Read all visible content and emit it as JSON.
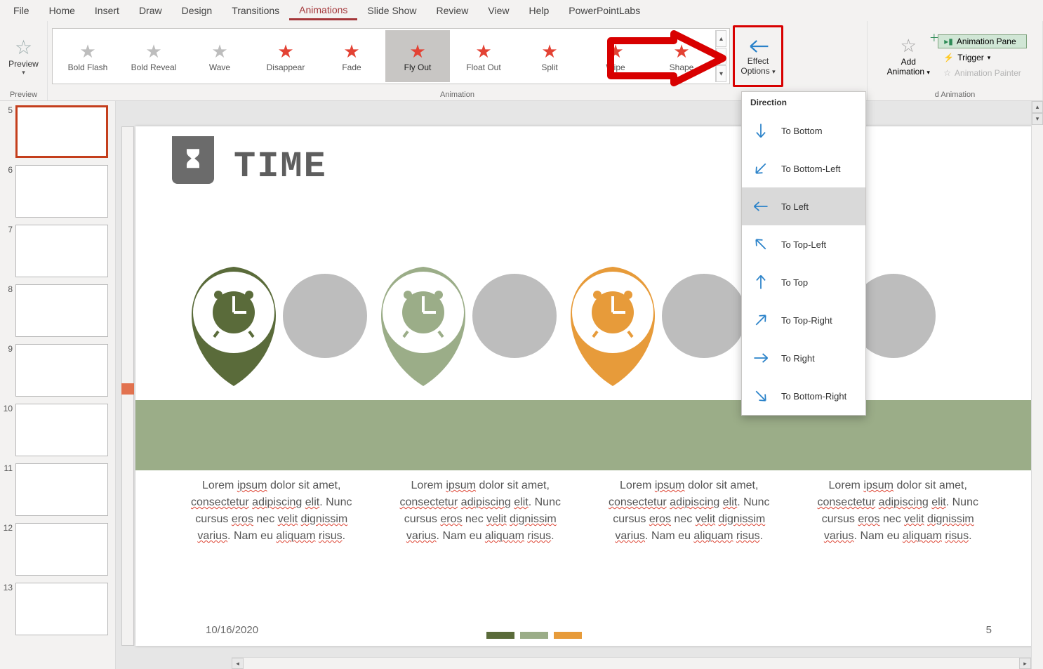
{
  "tabs": {
    "file": "File",
    "home": "Home",
    "insert": "Insert",
    "draw": "Draw",
    "design": "Design",
    "transitions": "Transitions",
    "animations": "Animations",
    "slideshow": "Slide Show",
    "review": "Review",
    "view": "View",
    "help": "Help",
    "labs": "PowerPointLabs"
  },
  "ribbon": {
    "preview": {
      "label": "Preview",
      "group": "Preview"
    },
    "animationGroup": "Animation",
    "gallery": [
      {
        "name": "Bold Flash",
        "style": "gray"
      },
      {
        "name": "Bold Reveal",
        "style": "gray"
      },
      {
        "name": "Wave",
        "style": "gray"
      },
      {
        "name": "Disappear",
        "style": "red"
      },
      {
        "name": "Fade",
        "style": "red"
      },
      {
        "name": "Fly Out",
        "style": "red",
        "selected": true
      },
      {
        "name": "Float Out",
        "style": "red"
      },
      {
        "name": "Split",
        "style": "red"
      },
      {
        "name": "Wipe",
        "style": "red"
      },
      {
        "name": "Shape",
        "style": "red"
      }
    ],
    "effectOptions": {
      "line1": "Effect",
      "line2": "Options"
    },
    "addAnimation": {
      "line1": "Add",
      "line2": "Animation"
    },
    "advanced": {
      "pane": "Animation Pane",
      "trigger": "Trigger",
      "painter": "Animation Painter",
      "group": "d Animation"
    }
  },
  "dropdown": {
    "header": "Direction",
    "items": [
      {
        "label": "To Bottom",
        "rot": 90
      },
      {
        "label": "To Bottom-Left",
        "rot": 135
      },
      {
        "label": "To Left",
        "rot": 180,
        "selected": true
      },
      {
        "label": "To Top-Left",
        "rot": 225
      },
      {
        "label": "To Top",
        "rot": 270
      },
      {
        "label": "To Top-Right",
        "rot": 315
      },
      {
        "label": "To Right",
        "rot": 0
      },
      {
        "label": "To Bottom-Right",
        "rot": 45
      }
    ]
  },
  "thumbs": {
    "numbers": [
      "5",
      "6",
      "7",
      "8",
      "9",
      "10",
      "11",
      "12",
      "13"
    ],
    "selectedIndex": 0
  },
  "slide": {
    "title": "TIME",
    "date": "10/16/2020",
    "page": "5",
    "bodyText": "Lorem ipsum dolor sit amet, consectetur adipiscing elit. Nunc cursus eros nec velit dignissim varius. Nam eu aliquam risus.",
    "colorTabs": [
      "#5a6b3a",
      "#9bad88",
      "#e79b3a"
    ],
    "pins": [
      {
        "fill": "#5a6b3a"
      },
      {
        "fill": "#9bad88"
      },
      {
        "fill": "#e79b3a"
      }
    ]
  }
}
